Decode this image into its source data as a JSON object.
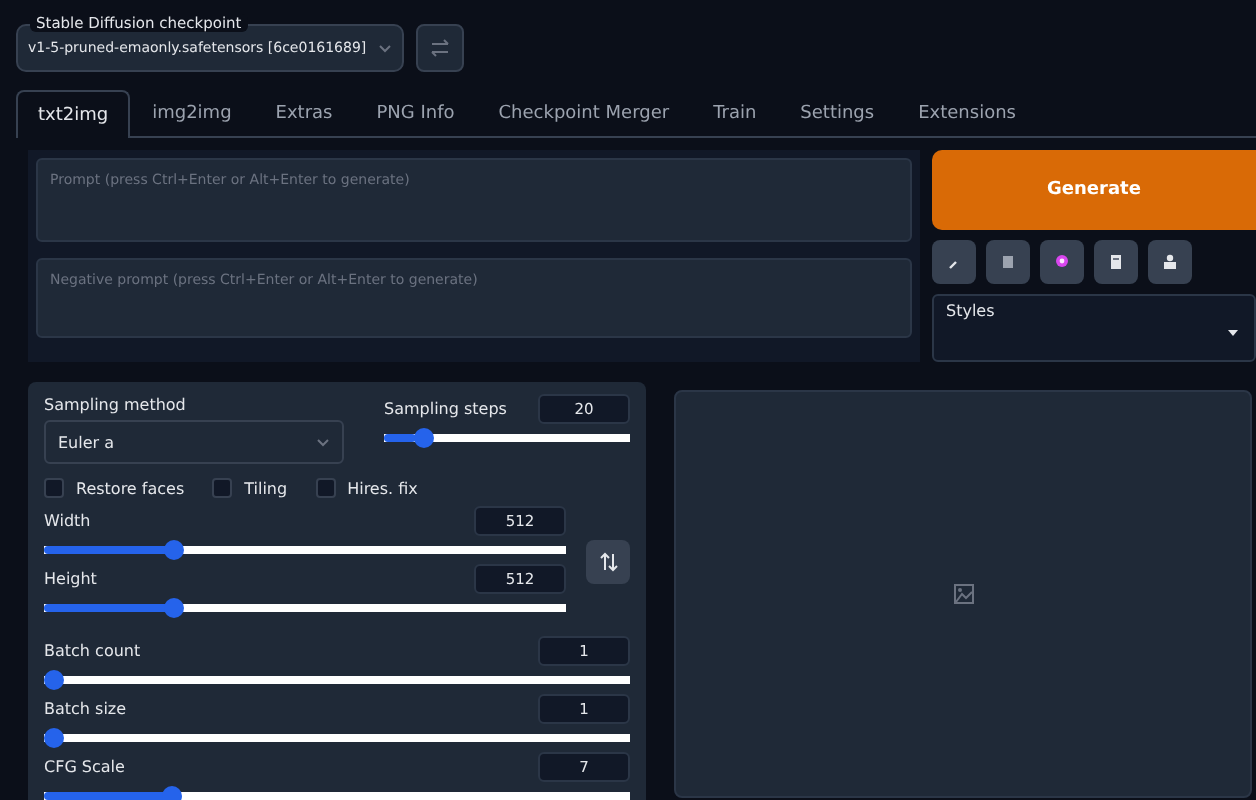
{
  "checkpoint": {
    "label": "Stable Diffusion checkpoint",
    "value": "v1-5-pruned-emaonly.safetensors [6ce0161689]"
  },
  "tabs": [
    {
      "label": "txt2img",
      "selected": true
    },
    {
      "label": "img2img",
      "selected": false
    },
    {
      "label": "Extras",
      "selected": false
    },
    {
      "label": "PNG Info",
      "selected": false
    },
    {
      "label": "Checkpoint Merger",
      "selected": false
    },
    {
      "label": "Train",
      "selected": false
    },
    {
      "label": "Settings",
      "selected": false
    },
    {
      "label": "Extensions",
      "selected": false
    }
  ],
  "prompt": {
    "placeholder": "Prompt (press Ctrl+Enter or Alt+Enter to generate)"
  },
  "negative_prompt": {
    "placeholder": "Negative prompt (press Ctrl+Enter or Alt+Enter to generate)"
  },
  "generate_button": "Generate",
  "styles": {
    "label": "Styles"
  },
  "sampling_method": {
    "label": "Sampling method",
    "value": "Euler a"
  },
  "sampling_steps": {
    "label": "Sampling steps",
    "value": "20",
    "level": 0.13
  },
  "checkboxes": [
    {
      "label": "Restore faces",
      "checked": false
    },
    {
      "label": "Tiling",
      "checked": false
    },
    {
      "label": "Hires. fix",
      "checked": false
    }
  ],
  "sliders": [
    {
      "kind": "dim",
      "label": "Width",
      "value": "512",
      "level": 0.24
    },
    {
      "kind": "dim",
      "label": "Height",
      "value": "512",
      "level": 0.24
    },
    {
      "kind": "full",
      "label": "Batch count",
      "value": "1",
      "level": 0
    },
    {
      "kind": "full",
      "label": "Batch size",
      "value": "1",
      "level": 0
    },
    {
      "kind": "full",
      "label": "CFG Scale",
      "value": "7",
      "level": 0.21
    }
  ]
}
